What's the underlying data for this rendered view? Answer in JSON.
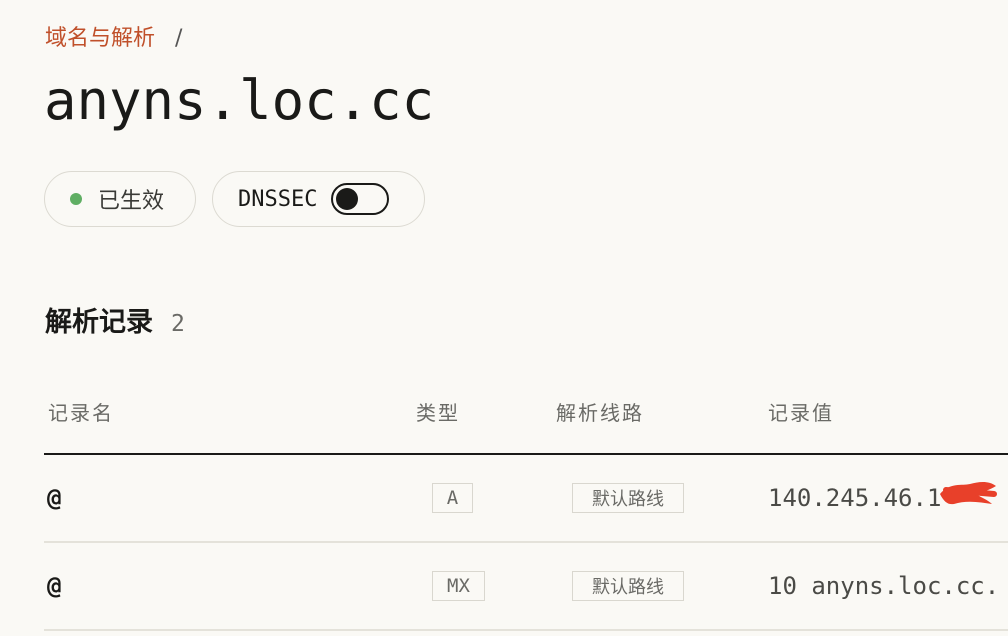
{
  "breadcrumb": {
    "parent": "域名与解析",
    "separator": "/"
  },
  "domain": {
    "name": "anyns.loc.cc"
  },
  "status": {
    "label": "已生效",
    "color": "#5fae63"
  },
  "dnssec": {
    "label": "DNSSEC",
    "enabled": false
  },
  "records_section": {
    "title": "解析记录",
    "count": "2"
  },
  "table": {
    "columns": [
      "记录名",
      "类型",
      "解析线路",
      "记录值"
    ],
    "rows": [
      {
        "name": "@",
        "type": "A",
        "line": "默认路线",
        "value": "140.245.46.1"
      },
      {
        "name": "@",
        "type": "MX",
        "line": "默认路线",
        "value": "10 anyns.loc.cc."
      }
    ]
  },
  "colors": {
    "accent": "#c0502a",
    "redaction": "#e8402a"
  }
}
